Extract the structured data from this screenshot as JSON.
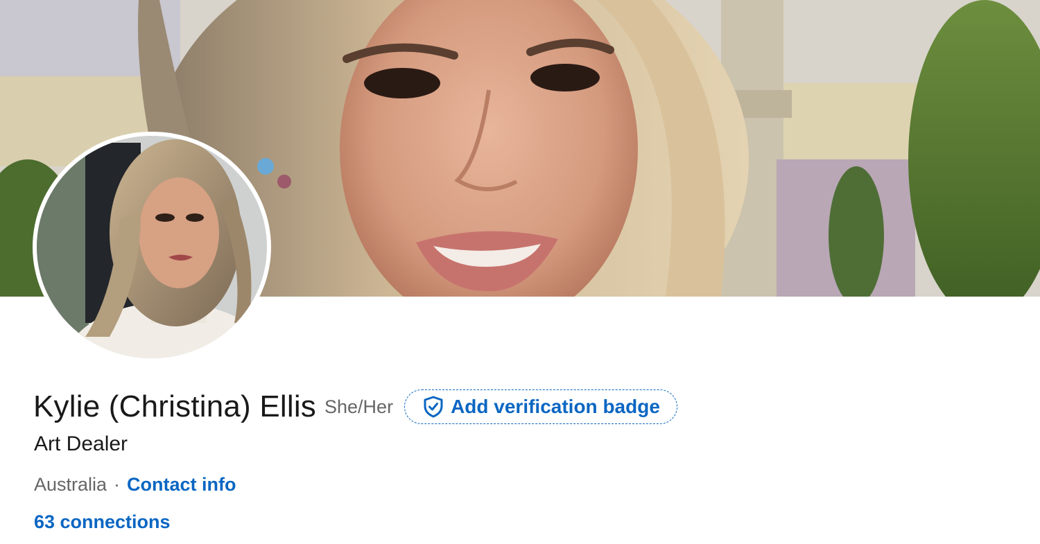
{
  "profile": {
    "name": "Kylie (Christina) Ellis",
    "pronouns": "She/Her",
    "headline": "Art Dealer",
    "location": "Australia",
    "separator": "·",
    "contact_info_label": "Contact info",
    "connections_label": "63 connections"
  },
  "verification": {
    "label": "Add verification badge",
    "icon": "shield-check-icon"
  },
  "colors": {
    "link_blue": "#0a66c2",
    "text_primary": "#191919",
    "text_secondary": "#666666"
  }
}
